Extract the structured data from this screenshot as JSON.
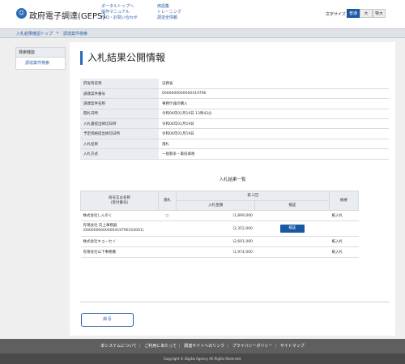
{
  "header": {
    "logo_text": "☺",
    "site_title": "政府電子調達(GEPS)",
    "links_col1": [
      "ポータルトップへ",
      "操作マニュアル",
      "FAQ・お問い合わせ"
    ],
    "links_col2": [
      "用語集",
      "トレーニング",
      "調達全情報"
    ],
    "font_size_label": "文字サイズ",
    "font_sizes": [
      "普通",
      "大",
      "特大"
    ],
    "active_font_size": "普通"
  },
  "breadcrumb": {
    "items": [
      "入札結果確認トップ",
      "調達案件検索"
    ],
    "separator": ">"
  },
  "sidebar": {
    "heading": "検索機能",
    "items": [
      "調達案件検索"
    ]
  },
  "main": {
    "title": "入札結果公開情報",
    "info_rows": [
      {
        "label": "府省等名称",
        "value": "法務省"
      },
      {
        "label": "調達案件番号",
        "value": "0000000000000419796"
      },
      {
        "label": "調達案件名称",
        "value": "事務什器の購入"
      },
      {
        "label": "開札日時",
        "value": "令和06年01月19日 13時42分"
      },
      {
        "label": "入札書提出締切日時",
        "value": "令和06年01月19日"
      },
      {
        "label": "予定価格提出締切日時",
        "value": "令和06年01月19日"
      },
      {
        "label": "入札結果",
        "value": "落札"
      },
      {
        "label": "入札方式",
        "value": "一般競争・最低価格"
      }
    ],
    "results_caption": "入札結果一覧",
    "results_headers": {
      "company": "商号又は名称\n(受付番号)",
      "winner": "落札",
      "round": "第１回",
      "amount": "入札金額",
      "detail": "検証",
      "remarks": "摘要"
    },
    "results_rows": [
      {
        "company": "株式会社しんのく",
        "winner": "○",
        "amount": "\\1,899,000",
        "detail": "",
        "remarks": "紙入札"
      },
      {
        "company": "有限会社 向上事務器\n(0000000000000419796310001)",
        "winner": "",
        "amount": "\\2,352,000",
        "detail": "検証",
        "remarks": ""
      },
      {
        "company": "株式会社キョーセイ",
        "winner": "",
        "amount": "\\2,601,000",
        "detail": "",
        "remarks": "紙入札"
      },
      {
        "company": "有限会社山下事務機",
        "winner": "",
        "amount": "\\1,974,000",
        "detail": "",
        "remarks": "紙入札"
      }
    ],
    "back_label": "戻る"
  },
  "footer": {
    "links": [
      "本システムについて",
      "ご利用にあたって",
      "関連サイトへのリンク",
      "プライバシーポリシー",
      "サイトマップ"
    ],
    "copyright": "Copyright © Digital Agency All Rights Reserved."
  },
  "colors": {
    "primary": "#1b58a4",
    "link": "#2a5fa6",
    "footer": "#5f5f5f"
  }
}
